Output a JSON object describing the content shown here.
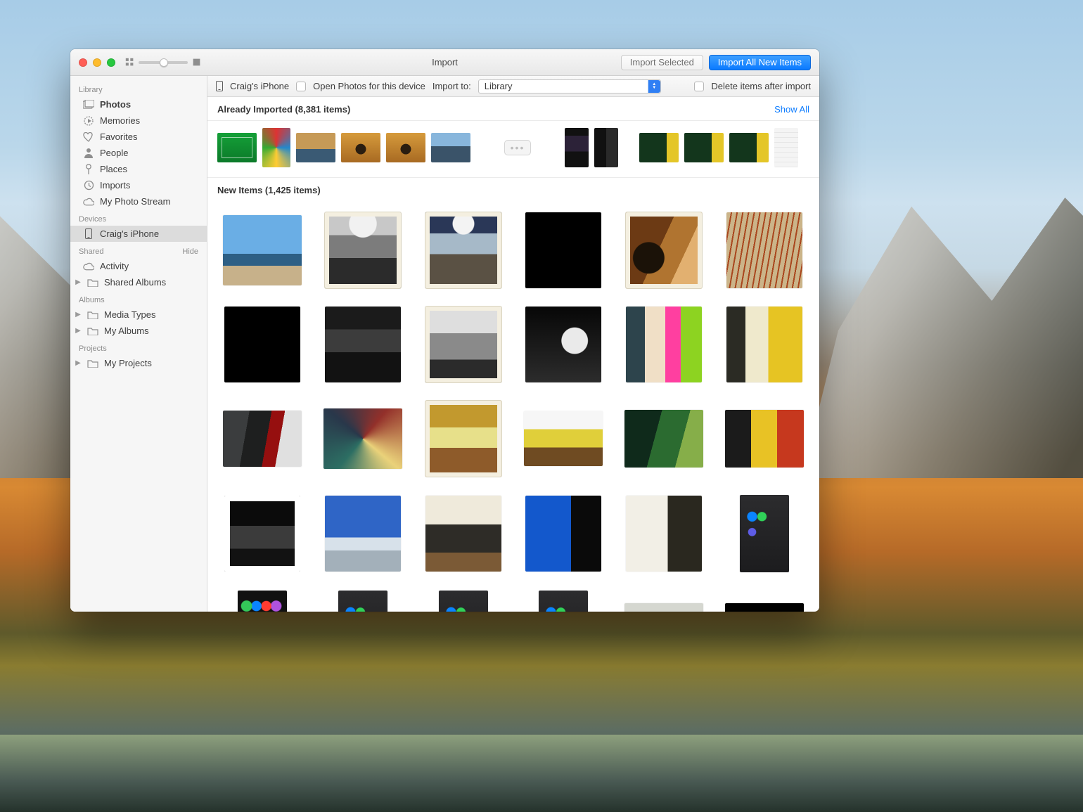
{
  "window": {
    "title": "Import"
  },
  "toolbar": {
    "import_selected": "Import Selected",
    "import_all": "Import All New Items"
  },
  "importBar": {
    "device": "Craig's iPhone",
    "open_photos_label": "Open Photos for this device",
    "import_to_label": "Import to:",
    "import_to_value": "Library",
    "delete_after_label": "Delete items after import"
  },
  "sidebar": {
    "sections": {
      "library": {
        "header": "Library",
        "items": [
          "Photos",
          "Memories",
          "Favorites",
          "People",
          "Places",
          "Imports",
          "My Photo Stream"
        ]
      },
      "devices": {
        "header": "Devices",
        "items": [
          "Craig's iPhone"
        ]
      },
      "shared": {
        "header": "Shared",
        "hide": "Hide",
        "items": [
          "Activity",
          "Shared Albums"
        ]
      },
      "albums": {
        "header": "Albums",
        "items": [
          "Media Types",
          "My Albums"
        ]
      },
      "projects": {
        "header": "Projects",
        "items": [
          "My Projects"
        ]
      }
    }
  },
  "sections": {
    "already": {
      "title": "Already Imported (8,381 items)",
      "show_all": "Show All"
    },
    "newitems": {
      "title": "New Items (1,425 items)"
    }
  }
}
